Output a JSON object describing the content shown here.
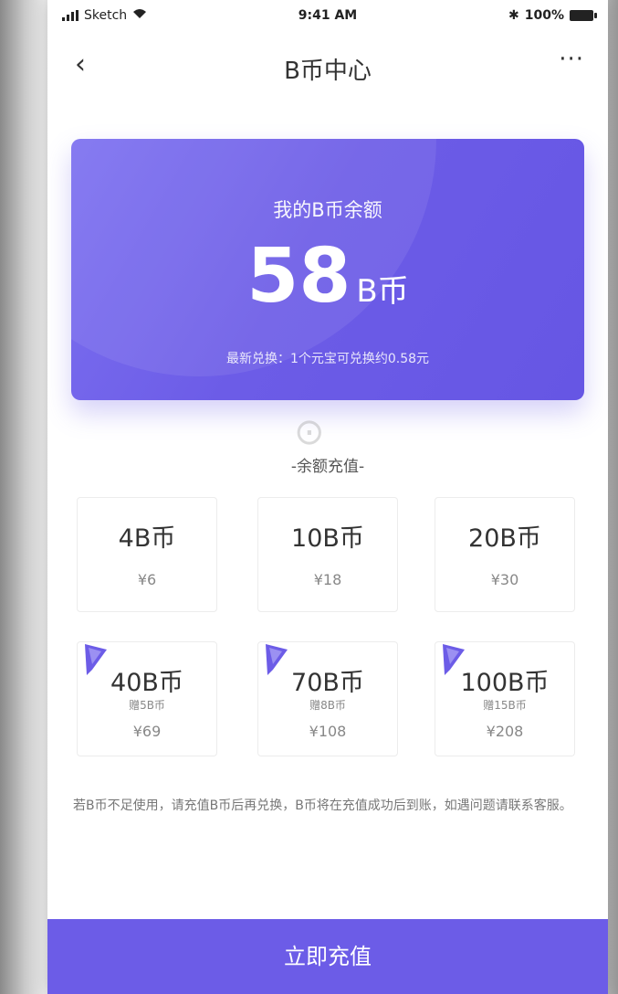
{
  "status_bar": {
    "carrier": "Sketch",
    "time": "9:41 AM",
    "battery": "100%"
  },
  "nav": {
    "back_icon": "‹",
    "title": "B币中心",
    "more_icon": "···"
  },
  "balance_card": {
    "label": "我的B币余额",
    "amount": "58",
    "unit": "B币",
    "note": "最新兑换：1个元宝可兑换约0.58元"
  },
  "recharge": {
    "section_title": "-余额充值-",
    "options": [
      {
        "amount": "4B币",
        "price": "¥6"
      },
      {
        "amount": "10B币",
        "price": "¥18"
      },
      {
        "amount": "20B币",
        "price": "¥30"
      }
    ],
    "promo_options": [
      {
        "amount": "40B币",
        "sub": "赠5B币",
        "price": "¥69"
      },
      {
        "amount": "70B币",
        "sub": "赠8B币",
        "price": "¥108"
      },
      {
        "amount": "100B币",
        "sub": "赠15B币",
        "price": "¥208"
      }
    ]
  },
  "notice": "若B币不足使用，请充值B币后再兑换，B币将在充值成功后到账，如遇问题请联系客服。",
  "cta_label": "立即充值",
  "colors": {
    "accent": "#6c5ce7",
    "card_bg": "#6c5ce7"
  }
}
